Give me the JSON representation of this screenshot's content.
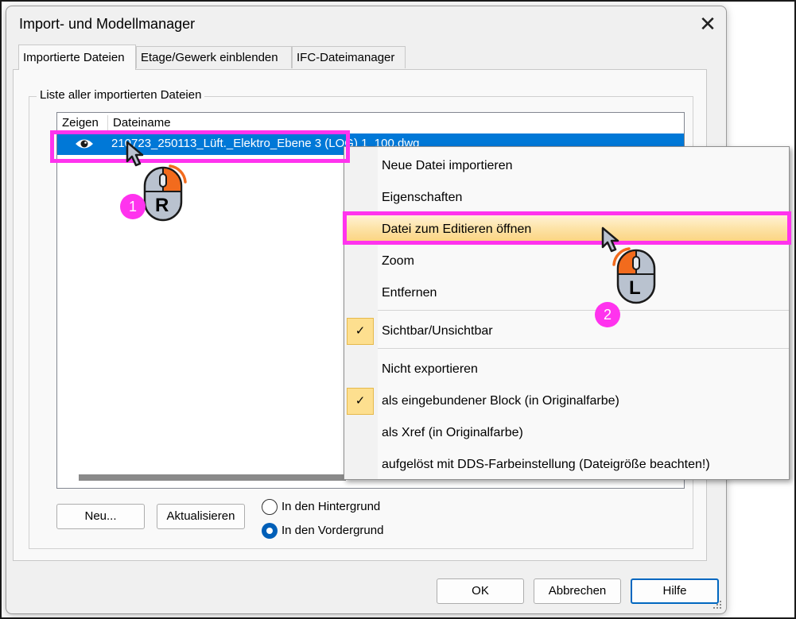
{
  "dialog": {
    "title": "Import- und Modellmanager",
    "close_label": "✕",
    "tabs": [
      {
        "label": "Importierte Dateien",
        "active": true
      },
      {
        "label": "Etage/Gewerk einblenden",
        "active": false
      },
      {
        "label": "IFC-Dateimanager",
        "active": false
      }
    ],
    "group_label": "Liste aller importierten Dateien",
    "list": {
      "columns": [
        "Zeigen",
        "Dateiname"
      ],
      "rows": [
        {
          "visible_icon": "eye-icon",
          "filename": "210723_250113_Lüft._Elektro_Ebene 3 (LOG) 1_100.dwg",
          "selected": true
        }
      ]
    },
    "buttons": {
      "new": "Neu...",
      "refresh": "Aktualisieren",
      "ok": "OK",
      "cancel": "Abbrechen",
      "help": "Hilfe"
    },
    "radio_options": [
      {
        "label": "In den Hintergrund",
        "checked": false
      },
      {
        "label": "In den Vordergrund",
        "checked": true
      }
    ]
  },
  "context_menu": {
    "items": [
      {
        "label": "Neue Datei importieren"
      },
      {
        "label": "Eigenschaften"
      },
      {
        "label": "Datei zum Editieren öffnen",
        "highlighted": true
      },
      {
        "label": "Zoom"
      },
      {
        "label": "Entfernen"
      },
      {
        "label": "Sichtbar/Unsichtbar",
        "checked": true
      },
      {
        "label": "Nicht exportieren"
      },
      {
        "label": "als eingebundener Block (in Originalfarbe)",
        "checked": true
      },
      {
        "label": "als Xref (in Originalfarbe)"
      },
      {
        "label": "aufgelöst mit DDS-Farbeinstellung (Dateigröße beachten!)"
      }
    ],
    "check_glyph": "✓"
  },
  "annotations": {
    "step1": {
      "number": "1",
      "mouse_button": "R"
    },
    "step2": {
      "number": "2",
      "mouse_button": "L"
    }
  },
  "colors": {
    "selection": "#0078d7",
    "highlight_frame": "#ff33ee",
    "menu_hover": "#fde3a7",
    "mouse_accent": "#f26b1d",
    "mouse_body": "#b9c2cf"
  }
}
